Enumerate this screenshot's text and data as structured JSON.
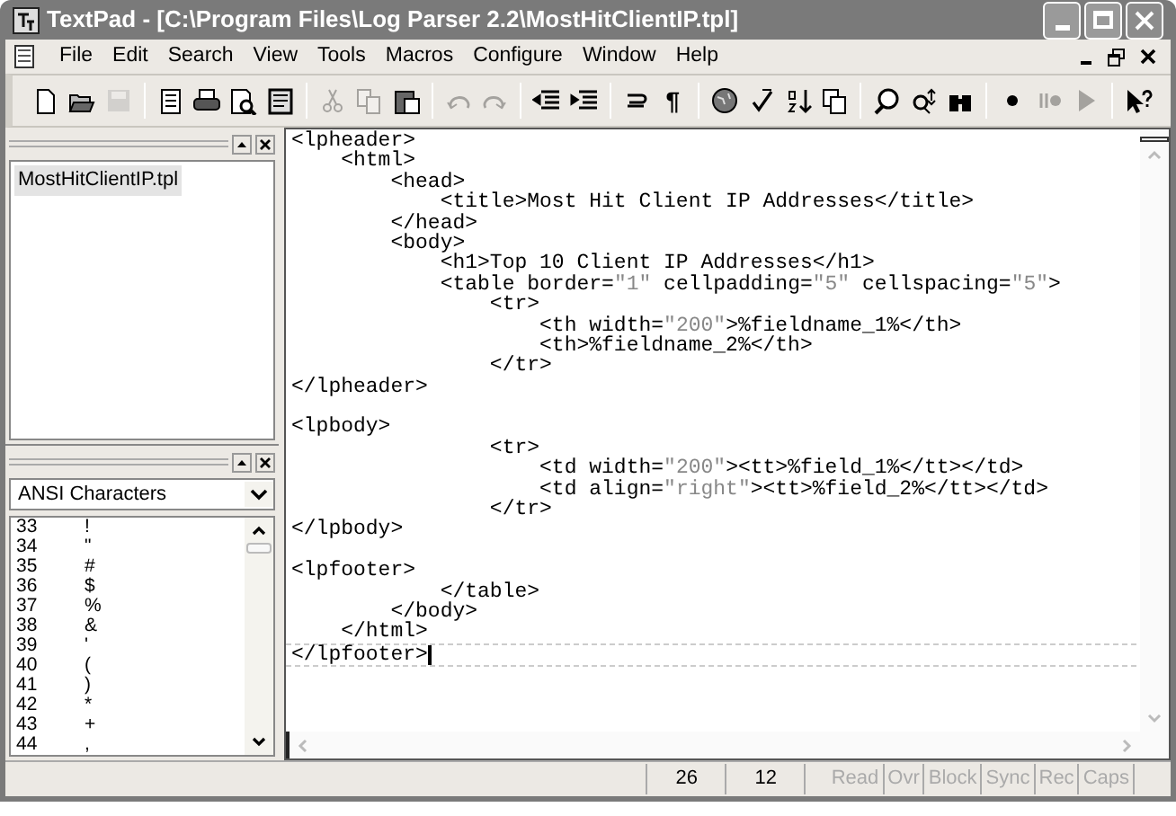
{
  "window": {
    "title": "TextPad - [C:\\Program Files\\Log Parser 2.2\\MostHitClientIP.tpl]"
  },
  "menu": [
    "File",
    "Edit",
    "Search",
    "View",
    "Tools",
    "Macros",
    "Configure",
    "Window",
    "Help"
  ],
  "toolbar": [
    [
      {
        "disabled": false
      },
      {
        "disabled": false
      },
      {
        "disabled": true
      }
    ],
    [
      {
        "disabled": false
      },
      {
        "disabled": false
      },
      {
        "disabled": false
      },
      {
        "disabled": false
      }
    ],
    [
      {
        "disabled": true
      },
      {
        "disabled": true
      },
      {
        "disabled": false
      }
    ],
    [
      {
        "disabled": true
      },
      {
        "disabled": true
      }
    ],
    [
      {
        "disabled": false
      },
      {
        "disabled": false
      }
    ],
    [
      {
        "disabled": false
      },
      {
        "disabled": false,
        "label": "¶"
      }
    ],
    [
      {
        "disabled": false
      },
      {
        "disabled": false
      },
      {
        "disabled": false
      },
      {
        "disabled": false
      }
    ],
    [
      {
        "disabled": false
      },
      {
        "disabled": false
      },
      {
        "disabled": false
      }
    ],
    [
      {
        "disabled": false
      },
      {
        "disabled": true
      },
      {
        "disabled": true
      }
    ],
    [
      {
        "disabled": false
      }
    ]
  ],
  "documents": [
    {
      "name": "MostHitClientIP.tpl",
      "selected": true
    }
  ],
  "clip_library": {
    "selector": "ANSI Characters",
    "rows": [
      [
        "33",
        "!"
      ],
      [
        "34",
        "\""
      ],
      [
        "35",
        "#"
      ],
      [
        "36",
        "$"
      ],
      [
        "37",
        "%"
      ],
      [
        "38",
        "&"
      ],
      [
        "39",
        "'"
      ],
      [
        "40",
        "("
      ],
      [
        "41",
        ")"
      ],
      [
        "42",
        "*"
      ],
      [
        "43",
        "+"
      ],
      [
        "44",
        ","
      ]
    ]
  },
  "editor": {
    "sections": [
      [
        "<lpheader>",
        "    <html>",
        "        <head>",
        "            <title>Most Hit Client IP Addresses</title>",
        "        </head>",
        "        <body>",
        "            <h1>Top 10 Client IP Addresses</h1>",
        "            <table border=\"1\" cellpadding=\"5\" cellspacing=\"5\">",
        "                <tr>",
        "                    <th width=\"200\">%fieldname_1%</th>",
        "                    <th>%fieldname_2%</th>",
        "                </tr>",
        "</lpheader>"
      ],
      [
        "<lpbody>",
        "                <tr>",
        "                    <td width=\"200\"><tt>%field_1%</tt></td>",
        "                    <td align=\"right\"><tt>%field_2%</tt></td>",
        "                </tr>",
        "</lpbody>"
      ],
      [
        "<lpfooter>",
        "            </table>",
        "        </body>",
        "    </html>",
        "</lpfooter>"
      ]
    ]
  },
  "status_bar": {
    "line": "26",
    "column": "12",
    "indicators": [
      {
        "label": "Read",
        "on": false
      },
      {
        "label": "Ovr",
        "on": false
      },
      {
        "label": "Block",
        "on": false
      },
      {
        "label": "Sync",
        "on": false
      },
      {
        "label": "Rec",
        "on": false
      },
      {
        "label": "Caps",
        "on": false
      }
    ]
  }
}
